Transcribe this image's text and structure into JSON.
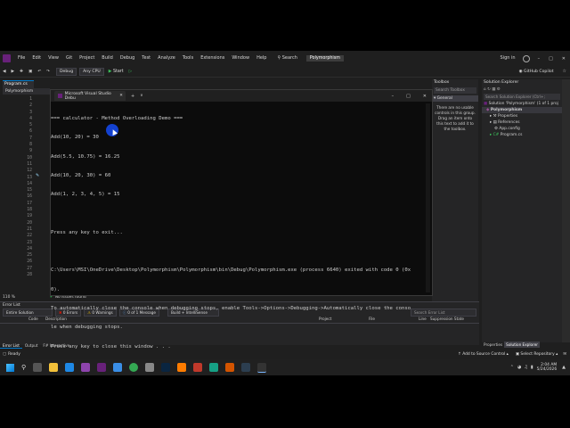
{
  "menu": [
    "File",
    "Edit",
    "View",
    "Git",
    "Project",
    "Build",
    "Debug",
    "Test",
    "Analyze",
    "Tools",
    "Extensions",
    "Window",
    "Help"
  ],
  "search": "Search",
  "solution_badge": "Polymorphism",
  "toolbar": {
    "config": "Debug",
    "platform": "Any CPU",
    "start": "Start",
    "copilot": "GitHub Copilot",
    "signin": "Sign in"
  },
  "doc_tab": "Program.cs",
  "scope": "Polymorphism",
  "line_numbers": [
    "1",
    "2",
    "3",
    "4",
    "5",
    "6",
    "7",
    "8",
    "9",
    "10",
    "11",
    "12",
    "13",
    "14",
    "15",
    "16",
    "17",
    "18",
    "19",
    "20",
    "21",
    "22",
    "23",
    "24",
    "25",
    "26",
    "27",
    "28"
  ],
  "zoom": "110 %",
  "no_issues": "No issues found",
  "console": {
    "tab_title": "Microsoft Visual Studio Debu",
    "lines": [
      "=== calculator - Method Overloading Demo ===",
      "Add(10, 20) = 30",
      "Add(5.5, 10.75) = 16.25",
      "Add(10, 20, 30) = 60",
      "Add(1, 2, 3, 4, 5) = 15",
      "",
      "Press any key to exit...",
      "",
      "C:\\Users\\MSI\\OneDrive\\Desktop\\Polymorphism\\Polymorphism\\bin\\Debug\\Polymorphism.exe (process 6640) exited with code 0 (0x",
      "0).",
      "To automatically close the console when debugging stops, enable Tools->Options->Debugging->Automatically close the conso",
      "le when debugging stops.",
      "Press any key to close this window . . ."
    ]
  },
  "toolbox": {
    "title": "Toolbox",
    "search": "Search Toolbox",
    "group": "General",
    "empty_text": "There are no usable controls in this group. Drag an item onto this text to add it to the toolbox."
  },
  "solution_explorer": {
    "title": "Solution Explorer",
    "search": "Search Solution Explorer (Ctrl+;",
    "items": [
      "Solution 'Polymorphism' (1 of 1 proj",
      "Polymorphism",
      "Properties",
      "References",
      "App.config",
      "Program.cs"
    ],
    "footer_tabs": [
      "Properties",
      "Solution Explorer"
    ]
  },
  "error_list": {
    "title": "Error List",
    "scope": "Entire Solution",
    "errors": "0 Errors",
    "warnings": "0 Warnings",
    "messages": "0 of 1 Message",
    "build": "Build + IntelliSense",
    "search": "Search Error List",
    "columns": [
      "Code",
      "Description",
      "Project",
      "File",
      "Line",
      "Suppression State"
    ],
    "bottom_tabs": [
      "Error List",
      "Output",
      "F# Interactive"
    ]
  },
  "status": {
    "ready": "Ready",
    "source_control": "Add to Source Control",
    "repo": "Select Repository"
  },
  "clock": {
    "time": "2:04 AM",
    "date": "5/24/2026"
  },
  "colors": {
    "accent": "#007acc",
    "vs_purple": "#68217a",
    "error": "#e51400",
    "warning": "#ffcc00",
    "console_bg": "#0c0c0c",
    "cursor_highlight": "#1447e6"
  }
}
